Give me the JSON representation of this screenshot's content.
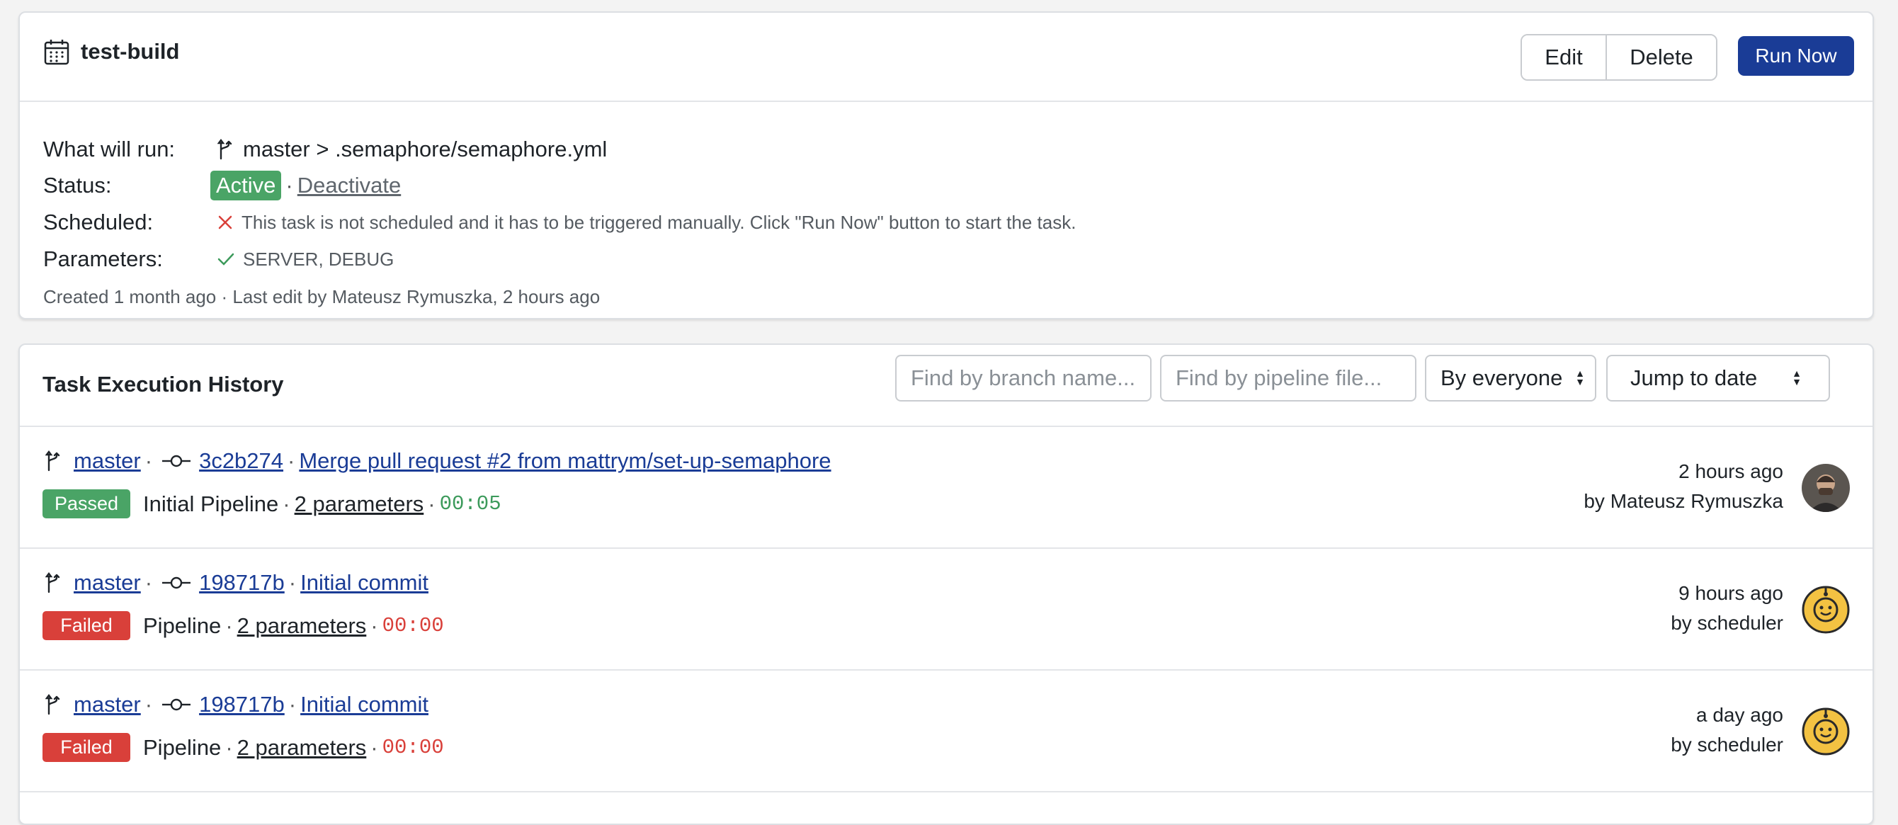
{
  "task": {
    "title": "test-build",
    "buttons": {
      "edit": "Edit",
      "delete": "Delete",
      "run_now": "Run Now"
    },
    "details": {
      "what_label": "What will run:",
      "what_value": "master > .semaphore/semaphore.yml",
      "status_label": "Status:",
      "status_badge": "Active",
      "status_action": "Deactivate",
      "scheduled_label": "Scheduled:",
      "scheduled_value": "This task is not scheduled and it has to be triggered manually. Click \"Run Now\" button to start the task.",
      "parameters_label": "Parameters:",
      "parameters_value": "SERVER, DEBUG"
    },
    "meta": "Created 1 month ago · Last edit by Mateusz Rymuszka, 2 hours ago"
  },
  "history": {
    "title": "Task Execution History",
    "branch_placeholder": "Find by branch name...",
    "pipeline_placeholder": "Find by pipeline file...",
    "by_select": "By everyone",
    "date_select": "Jump to date",
    "rows": [
      {
        "branch": "master",
        "commit": "3c2b274",
        "message": "Merge pull request #2 from mattrym/set-up-semaphore",
        "status": "Passed",
        "pipeline": "Initial Pipeline",
        "params": "2 parameters",
        "duration": "00:05",
        "time": "2 hours ago",
        "by": "by Mateusz Rymuszka"
      },
      {
        "branch": "master",
        "commit": "198717b",
        "message": "Initial commit",
        "status": "Failed",
        "pipeline": "Pipeline",
        "params": "2 parameters",
        "duration": "00:00",
        "time": "9 hours ago",
        "by": "by scheduler"
      },
      {
        "branch": "master",
        "commit": "198717b",
        "message": "Initial commit",
        "status": "Failed",
        "pipeline": "Pipeline",
        "params": "2 parameters",
        "duration": "00:00",
        "time": "a day ago",
        "by": "by scheduler"
      }
    ]
  },
  "colors": {
    "primary": "#1a3c96",
    "passed": "#4aa466",
    "failed": "#d9403a"
  }
}
